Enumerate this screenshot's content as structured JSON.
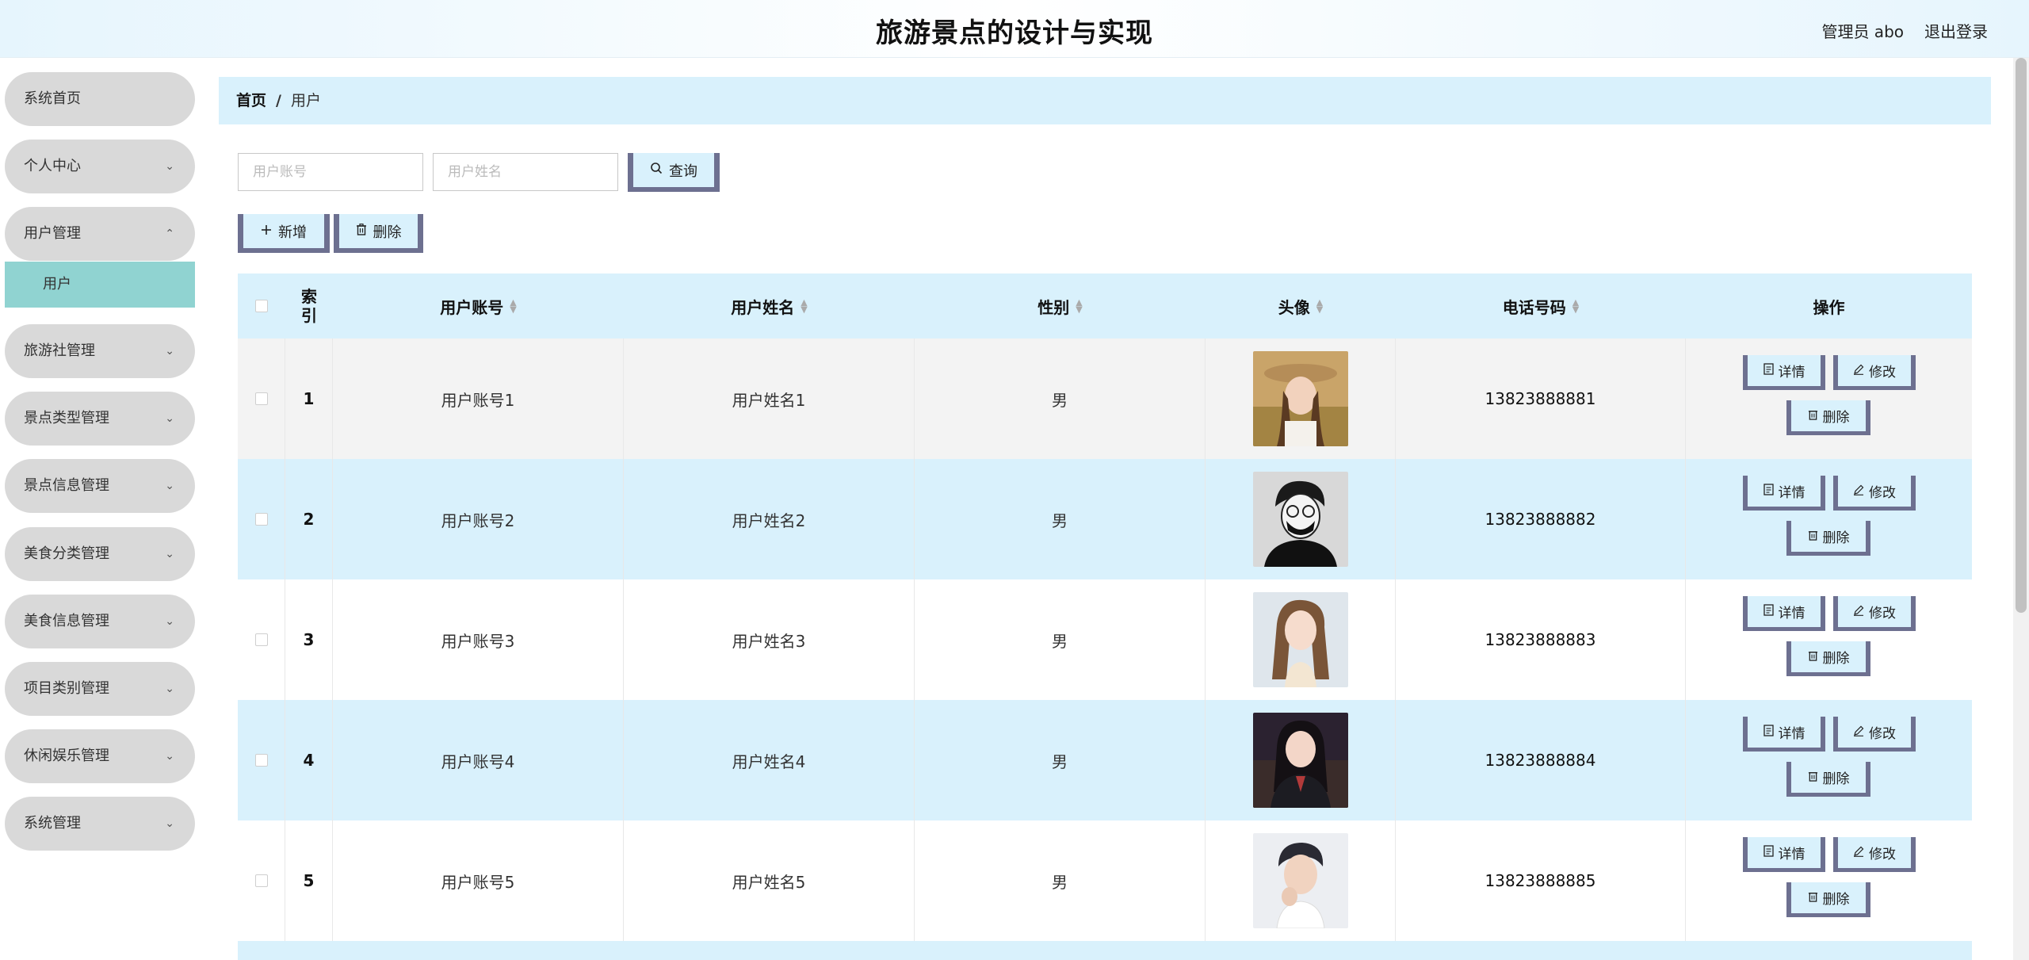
{
  "header": {
    "title": "旅游景点的设计与实现",
    "user": "管理员 abo",
    "logout": "退出登录"
  },
  "sidebar": {
    "items": [
      {
        "label": "系统首页",
        "chevron": ""
      },
      {
        "label": "个人中心",
        "chevron": "⌄"
      },
      {
        "label": "用户管理",
        "chevron": "⌃"
      },
      {
        "label": "旅游社管理",
        "chevron": "⌄"
      },
      {
        "label": "景点类型管理",
        "chevron": "⌄"
      },
      {
        "label": "景点信息管理",
        "chevron": "⌄"
      },
      {
        "label": "美食分类管理",
        "chevron": "⌄"
      },
      {
        "label": "美食信息管理",
        "chevron": "⌄"
      },
      {
        "label": "项目类别管理",
        "chevron": "⌄"
      },
      {
        "label": "休闲娱乐管理",
        "chevron": "⌄"
      },
      {
        "label": "系统管理",
        "chevron": "⌄"
      }
    ],
    "subitem": "用户"
  },
  "breadcrumb": {
    "home": "首页",
    "sep": "/",
    "current": "用户"
  },
  "search": {
    "account_placeholder": "用户账号",
    "name_placeholder": "用户姓名",
    "query_label": "查询"
  },
  "toolbar": {
    "add_label": "新增",
    "delete_label": "删除"
  },
  "table": {
    "headers": {
      "index": "索引",
      "account": "用户账号",
      "name": "用户姓名",
      "gender": "性别",
      "avatar": "头像",
      "phone": "电话号码",
      "actions": "操作"
    },
    "rows": [
      {
        "index": "1",
        "account": "用户账号1",
        "name": "用户姓名1",
        "gender": "男",
        "phone": "13823888881"
      },
      {
        "index": "2",
        "account": "用户账号2",
        "name": "用户姓名2",
        "gender": "男",
        "phone": "13823888882"
      },
      {
        "index": "3",
        "account": "用户账号3",
        "name": "用户姓名3",
        "gender": "男",
        "phone": "13823888883"
      },
      {
        "index": "4",
        "account": "用户账号4",
        "name": "用户姓名4",
        "gender": "男",
        "phone": "13823888884"
      },
      {
        "index": "5",
        "account": "用户账号5",
        "name": "用户姓名5",
        "gender": "男",
        "phone": "13823888885"
      }
    ],
    "row_actions": {
      "detail": "详情",
      "edit": "修改",
      "delete": "删除"
    }
  },
  "colors": {
    "accent_light": "#d9f1fc",
    "button_border": "#6d7090",
    "submenu_active": "#90d3d1",
    "menu_bg": "#d9d9d9"
  }
}
